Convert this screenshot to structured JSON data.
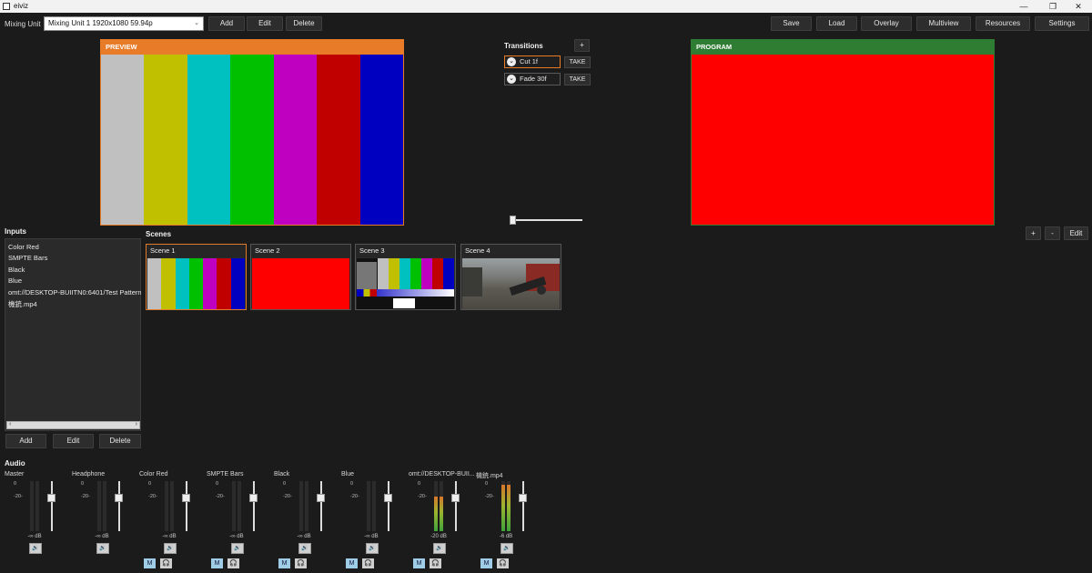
{
  "window": {
    "title": "eiviz"
  },
  "toolbar": {
    "mixing_unit_label": "Mixing Unit",
    "mixing_unit_value": "Mixing Unit 1  1920x1080 59.94p",
    "add": "Add",
    "edit": "Edit",
    "delete": "Delete",
    "save": "Save",
    "load": "Load",
    "overlay": "Overlay",
    "multiview": "Multiview",
    "resources": "Resources",
    "settings": "Settings"
  },
  "preview": {
    "title": "PREVIEW",
    "header_color": "#e77b27",
    "bars": [
      "#c0c0c0",
      "#c0c000",
      "#00c0c0",
      "#00c000",
      "#c000c0",
      "#c00000",
      "#0000c0"
    ]
  },
  "program": {
    "title": "PROGRAM",
    "header_color": "#2e7d32",
    "fill": "#ff0000"
  },
  "transitions": {
    "title": "Transitions",
    "add": "+",
    "items": [
      {
        "label": "Cut  1f",
        "take": "TAKE"
      },
      {
        "label": "Fade  30f",
        "take": "TAKE"
      }
    ],
    "tbar_position": 0
  },
  "scene_controls": {
    "add": "+",
    "remove": "-",
    "edit": "Edit"
  },
  "inputs": {
    "title": "Inputs",
    "items": [
      "Color Red",
      "SMPTE Bars",
      "Black",
      "Blue",
      "omt://DESKTOP-BUIITN0:6401/Test Patternw",
      "機銃.mp4"
    ],
    "add": "Add",
    "edit": "Edit",
    "delete": "Delete"
  },
  "scenes": {
    "title": "Scenes",
    "items": [
      {
        "label": "Scene 1"
      },
      {
        "label": "Scene 2"
      },
      {
        "label": "Scene 3"
      },
      {
        "label": "Scene 4"
      }
    ]
  },
  "audio": {
    "title": "Audio",
    "scale_top": "0",
    "scale_mid": "-20-",
    "channels": [
      {
        "name": "Master",
        "db": "-∞ dB",
        "level": 0,
        "fader": 0.75,
        "m": "",
        "h": ""
      },
      {
        "name": "Headphone",
        "db": "-∞ dB",
        "level": 0,
        "fader": 0.75,
        "m": "",
        "h": ""
      },
      {
        "name": "Color Red",
        "db": "-∞ dB",
        "level": 0,
        "fader": 0.75,
        "m": "M",
        "h": "🎧"
      },
      {
        "name": "SMPTE Bars",
        "db": "-∞ dB",
        "level": 0,
        "fader": 0.75,
        "m": "M",
        "h": "🎧"
      },
      {
        "name": "Black",
        "db": "-∞ dB",
        "level": 0,
        "fader": 0.75,
        "m": "M",
        "h": "🎧"
      },
      {
        "name": "Blue",
        "db": "-∞ dB",
        "level": 0,
        "fader": 0.75,
        "m": "M",
        "h": "🎧"
      },
      {
        "name": "omt://DESKTOP-BUII...",
        "db": "-20 dB",
        "level": 0.7,
        "fader": 0.75,
        "m": "M",
        "h": "🎧"
      },
      {
        "name": "機銃.mp4",
        "db": "-6 dB",
        "level": 0.93,
        "fader": 0.75,
        "m": "M",
        "h": "🎧"
      }
    ]
  }
}
